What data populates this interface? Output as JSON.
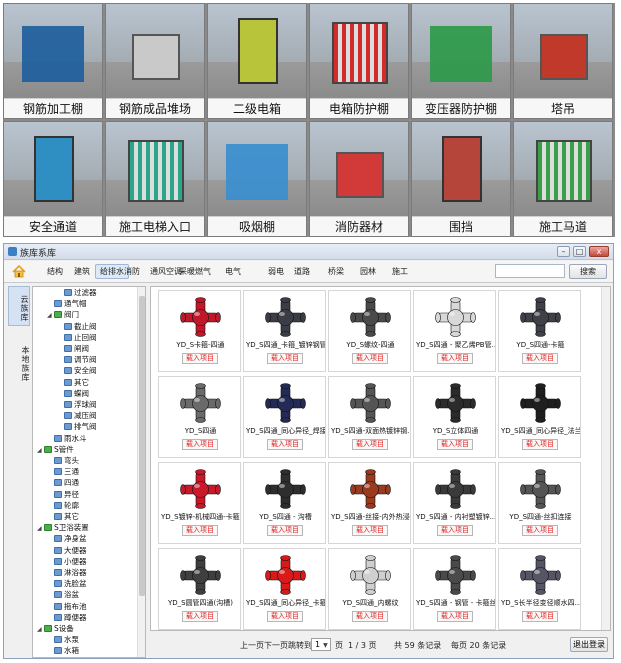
{
  "gallery": [
    {
      "label": "钢筋加工棚",
      "icon": "steel-processing-shed",
      "color": "#1f5f9e"
    },
    {
      "label": "钢筋成品堆场",
      "icon": "rebar-storage-yard",
      "color": "#c9c9c9"
    },
    {
      "label": "二级电箱",
      "icon": "secondary-electric-box",
      "color": "#b8c53a"
    },
    {
      "label": "电箱防护棚",
      "icon": "electric-box-shelter",
      "color": "#d22b2b"
    },
    {
      "label": "变压器防护棚",
      "icon": "transformer-shelter",
      "color": "#2e9a4a"
    },
    {
      "label": "塔吊",
      "icon": "tower-crane",
      "color": "#c0392b"
    },
    {
      "label": "安全通道",
      "icon": "safety-passage",
      "color": "#2f8fc2"
    },
    {
      "label": "施工电梯入口",
      "icon": "construction-elevator-entrance",
      "color": "#2aa68a"
    },
    {
      "label": "吸烟棚",
      "icon": "smoking-shelter",
      "color": "#3a8fd0"
    },
    {
      "label": "消防器材",
      "icon": "fire-equipment",
      "color": "#d23a3a"
    },
    {
      "label": "围挡",
      "icon": "hoarding-fence",
      "color": "#b5443a"
    },
    {
      "label": "施工马道",
      "icon": "construction-ramp",
      "color": "#3aa048"
    }
  ],
  "window": {
    "title": "族库系库",
    "categories": [
      "结构",
      "建筑",
      "给排水",
      "消防",
      "通风空调",
      "采暖燃气",
      "电气",
      "弱电",
      "道路",
      "桥梁",
      "园林",
      "施工"
    ],
    "active_category": "给排水",
    "search_button": "搜索",
    "search_value": "",
    "left_tabs": [
      {
        "label": "云族库",
        "active": true
      },
      {
        "label": "本地族库",
        "active": false
      }
    ],
    "tree": [
      {
        "label": "过滤器",
        "level": 3,
        "type": "item"
      },
      {
        "label": "通气帽",
        "level": 2,
        "type": "item"
      },
      {
        "label": "阀门",
        "level": 2,
        "type": "folder",
        "toggle": "◢"
      },
      {
        "label": "截止阀",
        "level": 3,
        "type": "item"
      },
      {
        "label": "止回阀",
        "level": 3,
        "type": "item"
      },
      {
        "label": "闸阀",
        "level": 3,
        "type": "item"
      },
      {
        "label": "调节阀",
        "level": 3,
        "type": "item"
      },
      {
        "label": "安全阀",
        "level": 3,
        "type": "item"
      },
      {
        "label": "其它",
        "level": 3,
        "type": "item"
      },
      {
        "label": "蝶阀",
        "level": 3,
        "type": "item"
      },
      {
        "label": "浮球阀",
        "level": 3,
        "type": "item"
      },
      {
        "label": "减压阀",
        "level": 3,
        "type": "item"
      },
      {
        "label": "排气阀",
        "level": 3,
        "type": "item"
      },
      {
        "label": "雨水斗",
        "level": 2,
        "type": "item"
      },
      {
        "label": "S管件",
        "level": 1,
        "type": "folder",
        "toggle": "◢"
      },
      {
        "label": "弯头",
        "level": 2,
        "type": "item"
      },
      {
        "label": "三通",
        "level": 2,
        "type": "item"
      },
      {
        "label": "四通",
        "level": 2,
        "type": "item"
      },
      {
        "label": "异径",
        "level": 2,
        "type": "item"
      },
      {
        "label": "轮廓",
        "level": 2,
        "type": "item"
      },
      {
        "label": "其它",
        "level": 2,
        "type": "item"
      },
      {
        "label": "S卫浴装置",
        "level": 1,
        "type": "folder",
        "toggle": "◢"
      },
      {
        "label": "净身盆",
        "level": 2,
        "type": "item"
      },
      {
        "label": "大便器",
        "level": 2,
        "type": "item"
      },
      {
        "label": "小便器",
        "level": 2,
        "type": "item"
      },
      {
        "label": "淋浴器",
        "level": 2,
        "type": "item"
      },
      {
        "label": "洗脸盆",
        "level": 2,
        "type": "item"
      },
      {
        "label": "浴盆",
        "level": 2,
        "type": "item"
      },
      {
        "label": "拖布池",
        "level": 2,
        "type": "item"
      },
      {
        "label": "蹲便器",
        "level": 2,
        "type": "item"
      },
      {
        "label": "S设备",
        "level": 1,
        "type": "folder",
        "toggle": "◢"
      },
      {
        "label": "水泵",
        "level": 2,
        "type": "item"
      },
      {
        "label": "水箱",
        "level": 2,
        "type": "item"
      }
    ],
    "load_label": "载入项目",
    "items": [
      {
        "name": "YD_S卡箍-四通",
        "color": "#c0182a"
      },
      {
        "name": "YD_S四通_卡箍_镀锌钢管",
        "color": "#3a3d45"
      },
      {
        "name": "YD_S螺纹-四通",
        "color": "#4a4a4a"
      },
      {
        "name": "YD_S四通 - 聚乙烯PB管...",
        "color": "#d8d8d8"
      },
      {
        "name": "YD_S四通-卡箍",
        "color": "#3f4048"
      },
      {
        "name": "YD_S四通",
        "color": "#6a6a6a"
      },
      {
        "name": "YD_S四通_同心异径_焊接",
        "color": "#232a55"
      },
      {
        "name": "YD_S四通-双面热镀锌钢...",
        "color": "#555"
      },
      {
        "name": "YD_S立体四通",
        "color": "#2b2b2b"
      },
      {
        "name": "YD_S四通_同心异径_法兰",
        "color": "#1f1f1f"
      },
      {
        "name": "YD_S镀锌-机械四通-卡箍...",
        "color": "#c8182a"
      },
      {
        "name": "YD_S四通 - 沟槽",
        "color": "#2e2e2e"
      },
      {
        "name": "YD_S四通-丝接-内外热浸...",
        "color": "#9a3a1e"
      },
      {
        "name": "YD_S四通 - 内衬塑镀锌...",
        "color": "#3a3a3a"
      },
      {
        "name": "YD_S四通-丝扣连接",
        "color": "#555"
      },
      {
        "name": "YD_S圆管四通(沟槽)",
        "color": "#3f3f3f"
      },
      {
        "name": "YD_S四通_同心异径_卡箍",
        "color": "#d81a1a"
      },
      {
        "name": "YD_S四通_内螺纹",
        "color": "#cfcfcf"
      },
      {
        "name": "YD_S四通 - 钢管 - 卡箍丝扣",
        "color": "#4a4a4a"
      },
      {
        "name": "YD_S长半径变径顺水四...",
        "color": "#556"
      }
    ],
    "pager": {
      "prev": "上一页",
      "next": "下一页",
      "jump": "跳转到",
      "page_value": "1",
      "page_word": "页",
      "page_of": "1 / 3 页",
      "total": "共 59 条记录",
      "per_page": "每页 20 条记录",
      "logout": "退出登录"
    }
  }
}
